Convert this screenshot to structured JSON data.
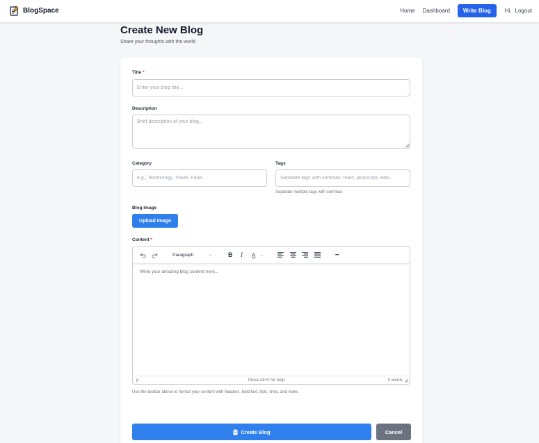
{
  "nav": {
    "brand": "BlogSpace",
    "brand_icon": "memo-icon",
    "links": [
      "Home",
      "Dashboard"
    ],
    "write_button": "Write Blog",
    "greeting": "Hi,",
    "logout": "Logout",
    "accent": "#2563eb"
  },
  "page": {
    "title": "Create New Blog",
    "subtitle": "Share your thoughts with the world"
  },
  "form": {
    "title_label": "Title",
    "required_mark": "*",
    "title_placeholder": "Enter your blog title...",
    "description_label": "Description",
    "description_placeholder": "Brief description of your blog...",
    "category_label": "Category",
    "category_placeholder": "e.g., Technology, Travel, Food...",
    "tags_label": "Tags",
    "tags_placeholder": "Separate tags with commas: react, javascript, web...",
    "tags_help": "Separate multiple tags with commas",
    "image_label": "Blog Image",
    "upload_button": "Upload Image",
    "content_label": "Content",
    "content_help": "Use the toolbar above to format your content with headers, bold text, lists, links, and more.",
    "create_button": "Create Blog",
    "create_icon": "clipboard-icon",
    "cancel_button": "Cancel"
  },
  "editor": {
    "block_format": "Paragraph",
    "bold": "B",
    "italic": "I",
    "text_color": "A",
    "more": "•••",
    "placeholder": "Write your amazing blog content here...",
    "status_path": "p",
    "status_hint": "Press Alt+0 for help",
    "word_count": "0 words"
  }
}
